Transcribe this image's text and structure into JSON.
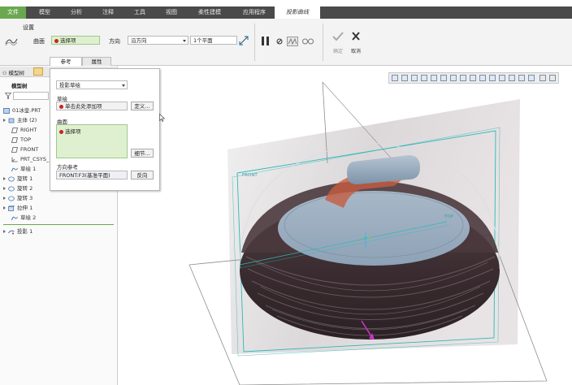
{
  "menu": {
    "tabs": [
      {
        "label": "文件"
      },
      {
        "label": "模型"
      },
      {
        "label": "分析"
      },
      {
        "label": "注释"
      },
      {
        "label": "工具"
      },
      {
        "label": "视图"
      },
      {
        "label": "柔性建模"
      },
      {
        "label": "应用程序"
      },
      {
        "label": "投影曲线"
      }
    ]
  },
  "ribbon": {
    "settings_label": "设置",
    "surface_label": "曲面",
    "surface_value": "选择项",
    "direction_label": "方向",
    "direction_value": "沿方向",
    "plane_value": "1个平面",
    "ok_label": "确定",
    "cancel_label": "取消",
    "tab_references": "参考",
    "tab_properties": "属性"
  },
  "flyout": {
    "type_value": "投影草绘",
    "sketch_label": "草绘",
    "sketch_value": "单击此处添加项",
    "define_button": "定义...",
    "surface_label": "曲面",
    "surface_value": "选择项",
    "details_button": "细节...",
    "dir_ref_label": "方向参考",
    "dir_ref_value": "FRONT:F3(基准平面)",
    "flip_button": "反向"
  },
  "left_panel": {
    "tab_model_tree": "模型树",
    "heading": "模型树",
    "items": [
      {
        "label": "01冰壶.PRT"
      },
      {
        "label": "主体 (2)"
      },
      {
        "label": "RIGHT"
      },
      {
        "label": "TOP"
      },
      {
        "label": "FRONT"
      },
      {
        "label": "PRT_CSYS_"
      },
      {
        "label": "草绘 1"
      },
      {
        "label": "旋转 1"
      },
      {
        "label": "旋转 2"
      },
      {
        "label": "旋转 3"
      },
      {
        "label": "拉伸 1"
      },
      {
        "label": "草绘 2"
      },
      {
        "label": "投影 1"
      }
    ]
  },
  "viewport": {
    "front_label": "FRONT",
    "top_label": "TOP"
  },
  "colors": {
    "accent_green": "#6aa84f",
    "menu_bg": "#4a4a4a",
    "plane_cyan": "#2fb8b8",
    "rock_dark": "#3d2f33",
    "handle_blue": "#8fa3b8"
  }
}
